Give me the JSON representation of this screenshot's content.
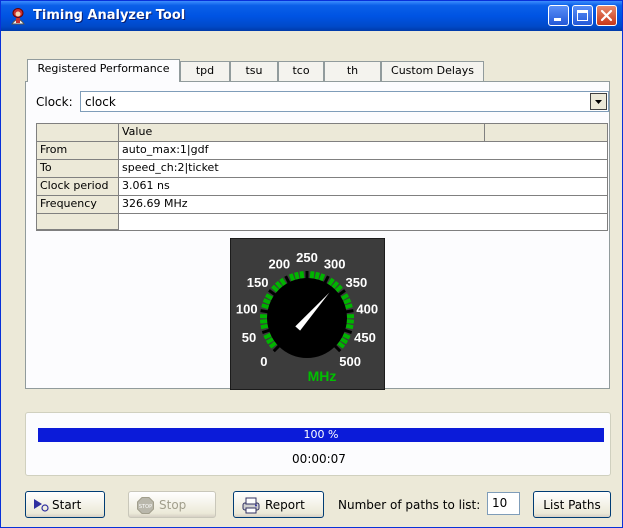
{
  "window": {
    "title": "Timing Analyzer Tool",
    "icon": "app-figure-icon",
    "controls": [
      "minimize-icon",
      "maximize-icon",
      "close-icon"
    ]
  },
  "tabs": [
    {
      "label": "Registered Performance",
      "active": true
    },
    {
      "label": "tpd",
      "active": false
    },
    {
      "label": "tsu",
      "active": false
    },
    {
      "label": "tco",
      "active": false
    },
    {
      "label": "th",
      "active": false
    },
    {
      "label": "Custom Delays",
      "active": false
    }
  ],
  "clock": {
    "label": "Clock:",
    "value": "clock"
  },
  "table": {
    "header": "Value",
    "rows": [
      {
        "name": "From",
        "value": "auto_max:1|gdf"
      },
      {
        "name": "To",
        "value": "speed_ch:2|ticket"
      },
      {
        "name": "Clock period",
        "value": "3.061 ns"
      },
      {
        "name": "Frequency",
        "value": "326.69 MHz"
      }
    ]
  },
  "gauge": {
    "unit": "MHz",
    "scale_labels": [
      "0",
      "50",
      "100",
      "150",
      "200",
      "250",
      "300",
      "350",
      "400",
      "450",
      "500"
    ],
    "needle_value": 326.69,
    "min": 0,
    "max": 500,
    "colors": {
      "face": "#3c3c3c",
      "ticks": "#00b400",
      "needle": "#ffffff",
      "unit": "#00c000"
    }
  },
  "progress": {
    "percent": 100,
    "text": "100 %",
    "elapsed": "00:00:07",
    "fill_color": "#0b1bd9"
  },
  "buttons": {
    "start": "Start",
    "stop": "Stop",
    "report": "Report",
    "list_paths": "List Paths"
  },
  "paths": {
    "label": "Number of paths to list:",
    "value": "10"
  }
}
